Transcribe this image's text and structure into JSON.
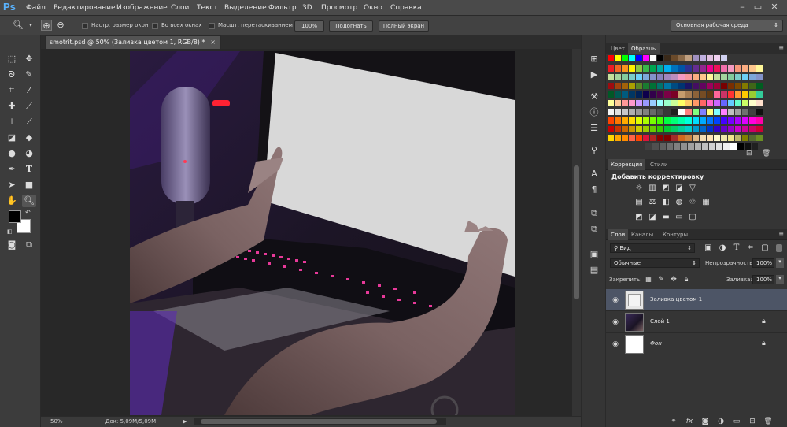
{
  "app": {
    "logo": "Ps"
  },
  "menu": [
    "Файл",
    "Редактирование",
    "Изображение",
    "Слои",
    "Текст",
    "Выделение",
    "Фильтр",
    "3D",
    "Просмотр",
    "Окно",
    "Справка"
  ],
  "options": {
    "resize_windows": "Настр. размер окон",
    "all_windows": "Во всех окнах",
    "scrubby_zoom": "Масшт. перетаскиванием",
    "btn_100": "100%",
    "btn_fit": "Подогнать",
    "btn_fullscreen": "Полный экран",
    "workspace": "Основная рабочая среда"
  },
  "document": {
    "tab_title": "smotrit.psd @ 50% (Заливка цветом 1, RGB/8) *",
    "close": "×"
  },
  "status": {
    "zoom": "50%",
    "doc_size": "Док: 5,09M/5,09M"
  },
  "swatches": {
    "tabs": [
      "Цвет",
      "Образцы"
    ]
  },
  "adjustments": {
    "tabs": [
      "Коррекция",
      "Стили"
    ],
    "title": "Добавить корректировку"
  },
  "layers_panel": {
    "tabs": [
      "Слои",
      "Каналы",
      "Контуры"
    ],
    "filter": "Вид",
    "blend_mode": "Обычные",
    "opacity_label": "Непрозрачность:",
    "opacity_value": "100%",
    "lock_label": "Закрепить:",
    "fill_label": "Заливка:",
    "fill_value": "100%",
    "layers": [
      {
        "name": "Заливка цветом 1",
        "selected": true
      },
      {
        "name": "Слой 1",
        "selected": false
      },
      {
        "name": "Фон",
        "selected": false
      }
    ]
  },
  "colors": {
    "accent": "#59b3ff",
    "selected_layer": "#4d5566",
    "fill_rect": "#d8d8d8"
  }
}
